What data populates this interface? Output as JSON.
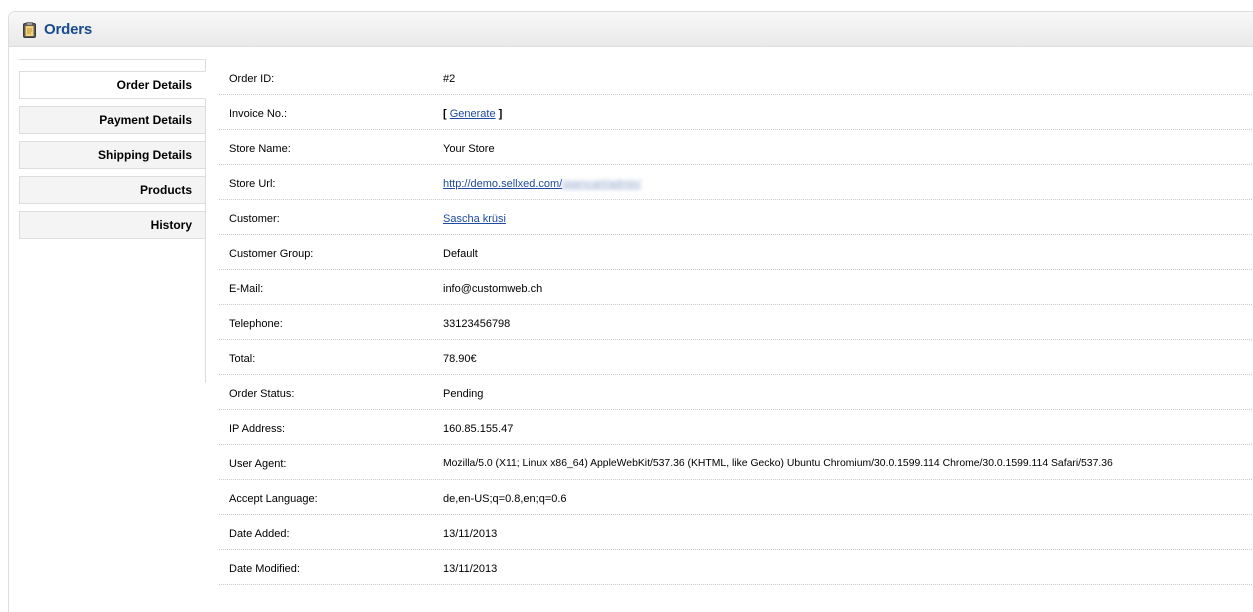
{
  "heading": {
    "title": "Orders",
    "icon": "clipboard-icon"
  },
  "tabs": [
    {
      "label": "Order Details",
      "active": true
    },
    {
      "label": "Payment Details",
      "active": false
    },
    {
      "label": "Shipping Details",
      "active": false
    },
    {
      "label": "Products",
      "active": false
    },
    {
      "label": "History",
      "active": false
    }
  ],
  "details": {
    "order_id": {
      "label": "Order ID:",
      "value": "#2"
    },
    "invoice": {
      "label": "Invoice No.:",
      "bracket_open": "[ ",
      "link": "Generate",
      "bracket_close": " ]"
    },
    "store_name": {
      "label": "Store Name:",
      "value": "Your Store"
    },
    "store_url": {
      "label": "Store Url:",
      "value": "http://demo.sellxed.com/",
      "blurred": "opencart/admin/"
    },
    "customer": {
      "label": "Customer:",
      "value": "Sascha krüsi"
    },
    "customer_group": {
      "label": "Customer Group:",
      "value": "Default"
    },
    "email": {
      "label": "E-Mail:",
      "value": "info@customweb.ch"
    },
    "telephone": {
      "label": "Telephone:",
      "value": "33123456798"
    },
    "total": {
      "label": "Total:",
      "value": "78.90€"
    },
    "order_status": {
      "label": "Order Status:",
      "value": "Pending"
    },
    "ip_address": {
      "label": "IP Address:",
      "value": "160.85.155.47"
    },
    "user_agent": {
      "label": "User Agent:",
      "value": "Mozilla/5.0 (X11; Linux x86_64) AppleWebKit/537.36 (KHTML, like Gecko) Ubuntu Chromium/30.0.1599.114 Chrome/30.0.1599.114 Safari/537.36"
    },
    "accept_language": {
      "label": "Accept Language:",
      "value": "de,en-US;q=0.8,en;q=0.6"
    },
    "date_added": {
      "label": "Date Added:",
      "value": "13/11/2013"
    },
    "date_modified": {
      "label": "Date Modified:",
      "value": "13/11/2013"
    }
  },
  "colors": {
    "heading_text": "#1a4a8e",
    "link": "#1f4aa0",
    "border": "#dddddd",
    "tab_bg": "#f4f4f4"
  }
}
